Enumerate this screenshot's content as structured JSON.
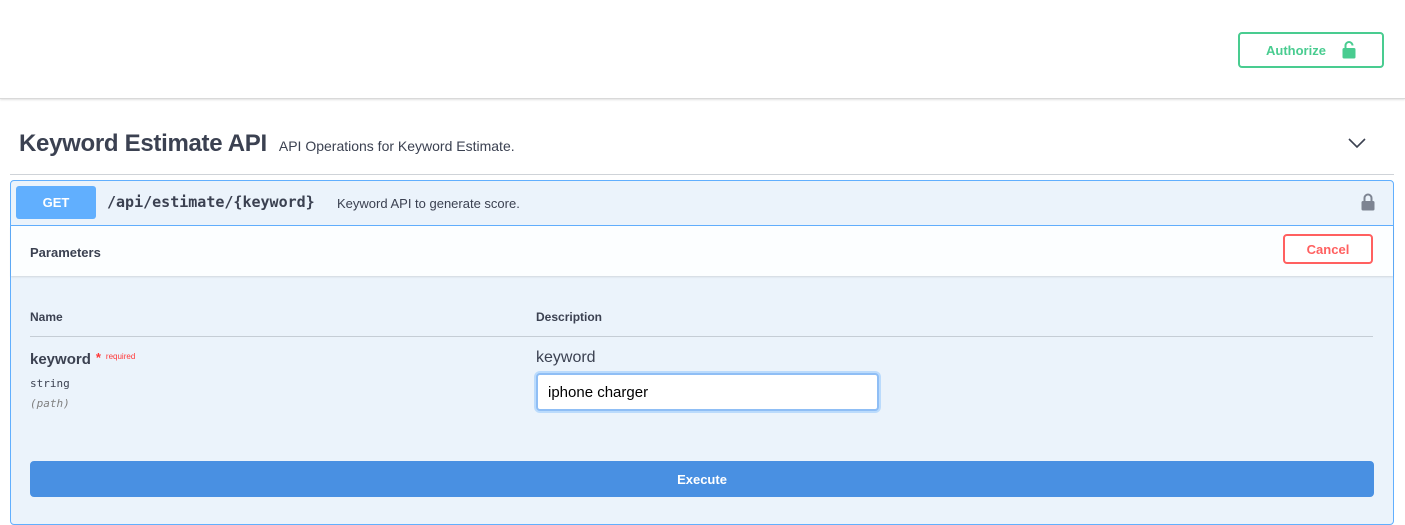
{
  "topbar": {
    "authorize_label": "Authorize",
    "authorize_color": "#49cc90"
  },
  "section": {
    "name": "Keyword Estimate API",
    "description": "API Operations for Keyword Estimate."
  },
  "operation": {
    "method": "GET",
    "method_color": "#61affe",
    "path": "/api/estimate/{keyword}",
    "summary": "Keyword API to generate score."
  },
  "parameters": {
    "title": "Parameters",
    "cancel_label": "Cancel",
    "columns": {
      "name": "Name",
      "description": "Description"
    },
    "items": [
      {
        "name": "keyword",
        "required_star": "*",
        "required_label": "required",
        "type": "string",
        "in": "(path)",
        "description": "keyword",
        "value": "iphone charger"
      }
    ]
  },
  "execute_label": "Execute",
  "icons": {
    "authorize": "unlocked-padlock-icon",
    "operation_lock": "padlock-icon",
    "collapse": "chevron-down-icon"
  }
}
